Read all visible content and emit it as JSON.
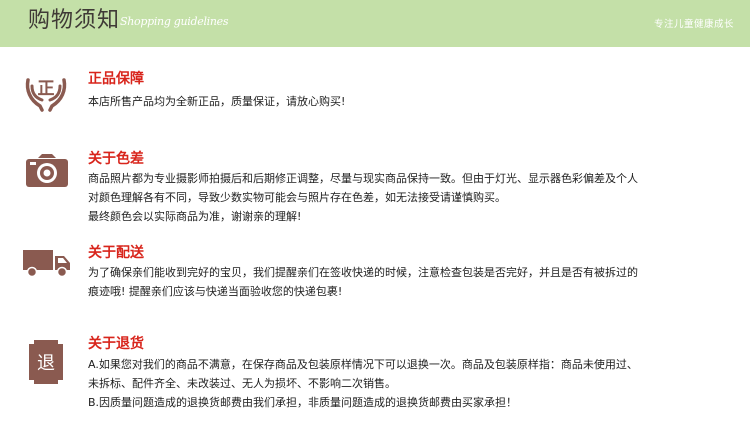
{
  "header": {
    "title": "购物须知",
    "subtitle": "Shopping guidelines",
    "slogan": "专注儿童健康成长"
  },
  "sections": [
    {
      "icon": "hands-holding-zheng-icon",
      "icon_char": "正",
      "title": "正品保障",
      "lines": [
        "本店所售产品均为全新正品，质量保证，请放心购买!"
      ]
    },
    {
      "icon": "camera-icon",
      "title": "关于色差",
      "lines": [
        "商品照片都为专业摄影师拍摄后和后期修正调整，尽量与现实商品保持一致。但由于灯光、显示器色彩偏差及个人",
        "对颜色理解各有不同，导致少数实物可能会与照片存在色差，如无法接受请谨慎购买。",
        "最终颜色会以实际商品为准，谢谢亲的理解!"
      ]
    },
    {
      "icon": "delivery-truck-icon",
      "title": "关于配送",
      "lines": [
        "为了确保亲们能收到完好的宝贝，我们提醒亲们在签收快递的时候，注意检查包装是否完好，并且是否有被拆过的",
        "痕迹哦! 提醒亲们应该与快递当面验收您的快递包裹!"
      ]
    },
    {
      "icon": "return-tui-icon",
      "icon_char": "退",
      "title": "关于退货",
      "lines": [
        "A.如果您对我们的商品不满意，在保存商品及包装原样情况下可以退换一次。商品及包装原样指：商品未使用过、",
        "未拆标、配件齐全、未改装过、无人为损坏、不影响二次销售。",
        "B.因质量问题造成的退换货邮费由我们承担，非质量问题造成的退换货邮费由买家承担！"
      ]
    }
  ],
  "colors": {
    "header_bg": "#c4e0a8",
    "title_red": "#d8251c",
    "icon_brown": "#8a5a50"
  }
}
